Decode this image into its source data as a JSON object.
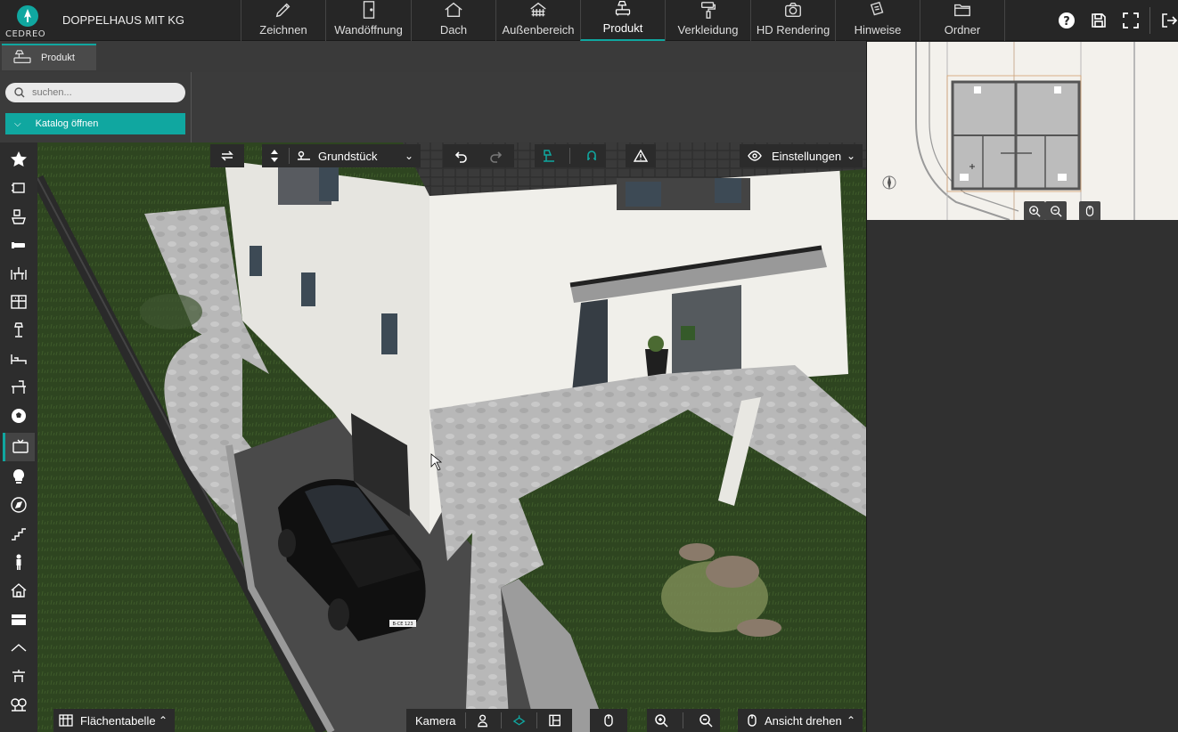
{
  "app": {
    "logo_text": "CEDREO",
    "project_title": "DOPPELHAUS MIT KG"
  },
  "top_nav": [
    {
      "id": "zeichnen",
      "label": "Zeichnen",
      "icon": "pencil-icon"
    },
    {
      "id": "wandoeffnung",
      "label": "Wandöffnung",
      "icon": "door-icon"
    },
    {
      "id": "dach",
      "label": "Dach",
      "icon": "roof-icon"
    },
    {
      "id": "aussenbereich",
      "label": "Außenbereich",
      "icon": "fence-icon"
    },
    {
      "id": "produkt",
      "label": "Produkt",
      "icon": "sofa-lamp-icon",
      "active": true
    },
    {
      "id": "verkleidung",
      "label": "Verkleidung",
      "icon": "paint-roller-icon"
    },
    {
      "id": "hd-rendering",
      "label": "HD Rendering",
      "icon": "camera-icon"
    },
    {
      "id": "hinweise",
      "label": "Hinweise",
      "icon": "notes-icon"
    },
    {
      "id": "ordner",
      "label": "Ordner",
      "icon": "folder-icon"
    }
  ],
  "top_right_icons": [
    "help-icon",
    "save-icon",
    "fullscreen-icon",
    "exit-icon"
  ],
  "tabs": {
    "produkt": "Produkt"
  },
  "search": {
    "placeholder": "suchen..."
  },
  "catalog": {
    "open_label": "Katalog öffnen"
  },
  "left_tools": [
    "star-icon",
    "window-frame-icon",
    "bathroom-icon",
    "sofa-icon",
    "dining-icon",
    "kitchen-icon",
    "lamp-stand-icon",
    "bed-icon",
    "office-desk-icon",
    "ball-icon",
    "tv-icon",
    "bulb-icon",
    "compass-icon",
    "stairs-icon",
    "person-icon",
    "house-icon",
    "storage-icon",
    "roof-line-icon",
    "garden-furniture-icon",
    "trees-icon"
  ],
  "active_left_tool": "tv-icon",
  "view_toolbar": {
    "level_select": "Grundstück",
    "settings_label": "Einstellungen"
  },
  "bottom_bar": {
    "area_table": "Flächentabelle",
    "camera": "Kamera",
    "rotate_view": "Ansicht drehen"
  },
  "scene": {
    "license_plate": "B-CE 123",
    "colors": {
      "accent": "#10a7a0",
      "grass": "#2f4a1f",
      "facade": "#ecebe6",
      "driveway": "#4a4a4a",
      "roof": "#3a3a3a",
      "stone": "#bdbdbd"
    }
  }
}
